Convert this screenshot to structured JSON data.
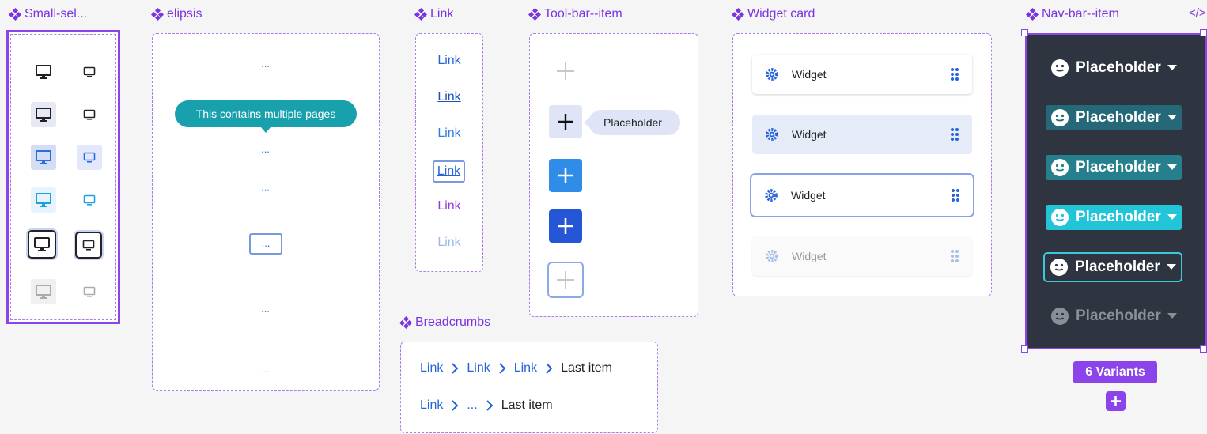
{
  "labels": {
    "small_select": "Small-sel...",
    "elipsis": "elipsis",
    "link": "Link",
    "toolbar": "Tool-bar--item",
    "widget": "Widget card",
    "navbar": "Nav-bar--item",
    "breadcrumbs": "Breadcrumbs",
    "code_icon": "</>"
  },
  "elipsis": {
    "dots": [
      "...",
      "...",
      "...",
      "...",
      "...",
      "..."
    ],
    "tooltip": "This contains multiple pages"
  },
  "links": [
    "Link",
    "Link",
    "Link",
    "Link",
    "Link",
    "Link"
  ],
  "toolbar": {
    "placeholder": "Placeholder"
  },
  "widget": {
    "label": "Widget"
  },
  "navbar": {
    "label": "Placeholder",
    "variants": "6 Variants"
  },
  "breadcrumbs": {
    "row1": [
      "Link",
      "Link",
      "Link",
      "Last item"
    ],
    "row2": [
      "Link",
      "...",
      "Last item"
    ]
  },
  "colors": {
    "accent": "#7b35e0",
    "link_blue": "#2563d9",
    "teal": "#1aa5b3",
    "nav_bg": "#2f3540"
  }
}
